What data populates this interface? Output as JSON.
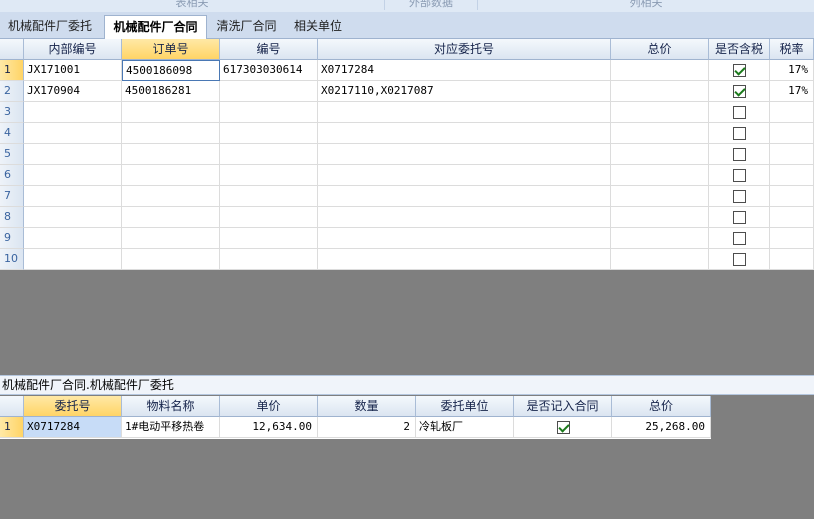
{
  "ribbon": {
    "groups": [
      "表相关",
      "外部数据",
      "列相关"
    ]
  },
  "tabs": [
    {
      "label": "机械配件厂委托",
      "active": false
    },
    {
      "label": "机械配件厂合同",
      "active": true
    },
    {
      "label": "清洗厂合同",
      "active": false
    },
    {
      "label": "相关单位",
      "active": false
    }
  ],
  "contract_grid": {
    "columns": [
      "内部编号",
      "订单号",
      "编号",
      "对应委托号",
      "总价",
      "是否含税",
      "税率"
    ],
    "selected_column": "订单号",
    "rows": [
      {
        "n": "1",
        "internal_no": "JX171001",
        "order_no": "4500186098",
        "code": "617303030614",
        "entrust_no": "X0717284",
        "total": "",
        "tax_included": true,
        "tax_rate": "17%"
      },
      {
        "n": "2",
        "internal_no": "JX170904",
        "order_no": "4500186281",
        "code": "",
        "entrust_no": "X0217110,X0217087",
        "total": "",
        "tax_included": true,
        "tax_rate": "17%"
      },
      {
        "n": "3",
        "internal_no": "",
        "order_no": "",
        "code": "",
        "entrust_no": "",
        "total": "",
        "tax_included": false,
        "tax_rate": ""
      },
      {
        "n": "4",
        "internal_no": "",
        "order_no": "",
        "code": "",
        "entrust_no": "",
        "total": "",
        "tax_included": false,
        "tax_rate": ""
      },
      {
        "n": "5",
        "internal_no": "",
        "order_no": "",
        "code": "",
        "entrust_no": "",
        "total": "",
        "tax_included": false,
        "tax_rate": ""
      },
      {
        "n": "6",
        "internal_no": "",
        "order_no": "",
        "code": "",
        "entrust_no": "",
        "total": "",
        "tax_included": false,
        "tax_rate": ""
      },
      {
        "n": "7",
        "internal_no": "",
        "order_no": "",
        "code": "",
        "entrust_no": "",
        "total": "",
        "tax_included": false,
        "tax_rate": ""
      },
      {
        "n": "8",
        "internal_no": "",
        "order_no": "",
        "code": "",
        "entrust_no": "",
        "total": "",
        "tax_included": false,
        "tax_rate": ""
      },
      {
        "n": "9",
        "internal_no": "",
        "order_no": "",
        "code": "",
        "entrust_no": "",
        "total": "",
        "tax_included": false,
        "tax_rate": ""
      },
      {
        "n": "10",
        "internal_no": "",
        "order_no": "",
        "code": "",
        "entrust_no": "",
        "total": "",
        "tax_included": false,
        "tax_rate": ""
      }
    ]
  },
  "subform_caption": "机械配件厂合同.机械配件厂委托",
  "entrust_grid": {
    "columns": [
      "委托号",
      "物料名称",
      "单价",
      "数量",
      "委托单位",
      "是否记入合同",
      "总价"
    ],
    "selected_column": "委托号",
    "rows": [
      {
        "n": "1",
        "entrust_no": "X0717284",
        "material": "1#电动平移热卷",
        "unit_price": "12,634.00",
        "qty": "2",
        "unit": "冷轧板厂",
        "in_contract": true,
        "total": "25,268.00"
      }
    ]
  }
}
